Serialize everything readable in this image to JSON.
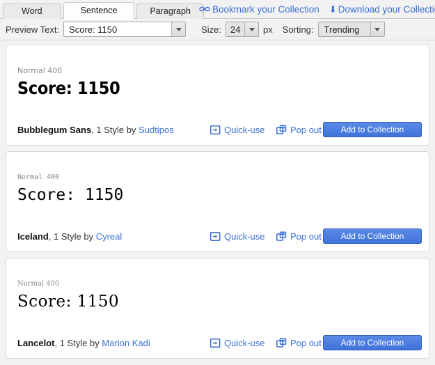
{
  "tabs": [
    {
      "label": "Word",
      "active": false
    },
    {
      "label": "Sentence",
      "active": true
    },
    {
      "label": "Paragraph",
      "active": false
    }
  ],
  "collection_links": [
    {
      "label": "Bookmark your Collection",
      "icon": "link-chain-icon"
    },
    {
      "label": "Download your Collection",
      "icon": "download-arrow-icon"
    }
  ],
  "controls": {
    "preview_text_label": "Preview Text:",
    "preview_text_value": "Score: 1150",
    "size_label": "Size:",
    "size_value": "24",
    "size_unit": "px",
    "sorting_label": "Sorting:",
    "sorting_value": "Trending"
  },
  "colors": {
    "link_blue": "#3b6fd4",
    "button_blue": "#4a7fe0",
    "page_bg": "#f2f2f2",
    "card_bg": "#ffffff",
    "muted_text": "#8a8a8a"
  },
  "actions": {
    "quick_use": "Quick-use",
    "pop_out": "Pop out",
    "add_to_collection": "Add to Collection"
  },
  "fonts": [
    {
      "weight_label": "Normal 400",
      "sample_text": "Score: 1150",
      "name": "Bubblegum Sans",
      "styles_text": ", 1 Style by ",
      "designer": "Sudtipos"
    },
    {
      "weight_label": "Normal 400",
      "sample_text": "Score: 1150",
      "name": "Iceland",
      "styles_text": ", 1 Style by ",
      "designer": "Cyreal"
    },
    {
      "weight_label": "Normal 400",
      "sample_text": "Score: 1150",
      "name": "Lancelot",
      "styles_text": ", 1 Style by ",
      "designer": "Marion Kadi"
    }
  ]
}
